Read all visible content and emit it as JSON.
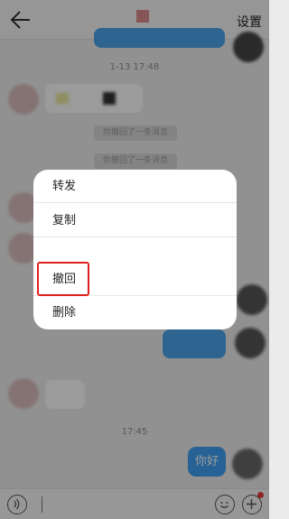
{
  "header": {
    "settings_label": "设置"
  },
  "chat": {
    "timestamp_1": "1-13 17:48",
    "system_tip_1": "你撤回了一条消息",
    "system_tip_2": "你撤回了一条消息",
    "timestamp_2": "17:45",
    "last_message": "你好"
  },
  "context_menu": {
    "items": [
      {
        "label": "转发"
      },
      {
        "label": "复制"
      },
      {
        "label": "撤回"
      },
      {
        "label": "删除"
      }
    ],
    "highlighted_index": 2
  },
  "colors": {
    "accent": "#3e9ef0",
    "highlight": "#e02020"
  }
}
